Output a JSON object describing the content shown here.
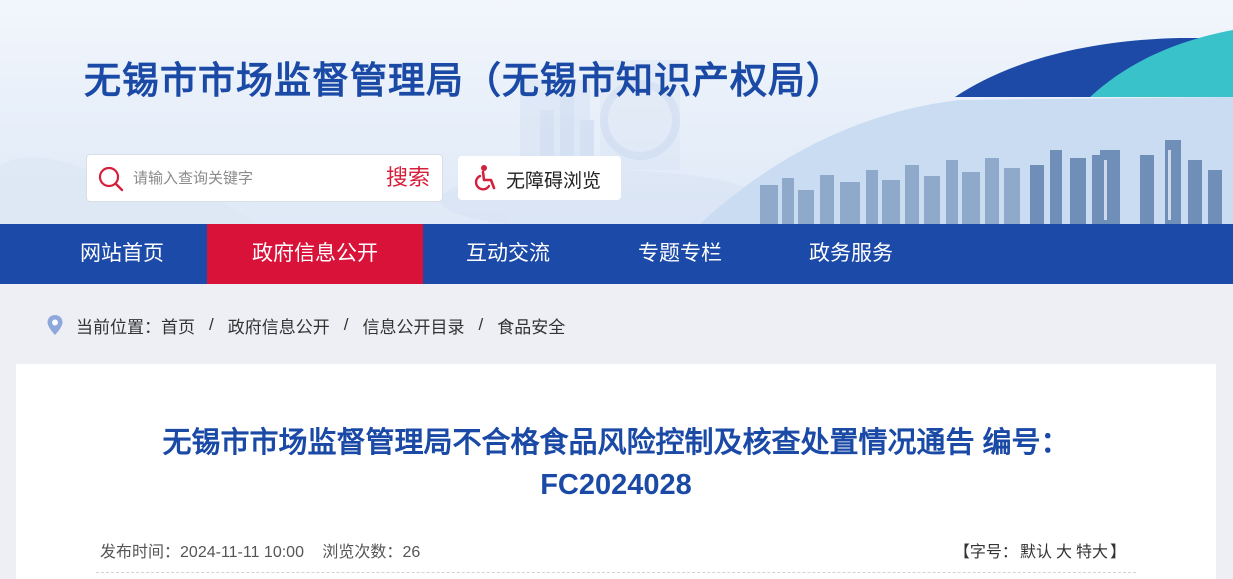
{
  "header": {
    "site_title": "无锡市市场监督管理局（无锡市知识产权局）"
  },
  "search": {
    "placeholder": "请输入查询关键字",
    "button_label": "搜索"
  },
  "accessibility": {
    "label": "无障碍浏览"
  },
  "nav": {
    "items": [
      {
        "label": "网站首页"
      },
      {
        "label": "政府信息公开"
      },
      {
        "label": "互动交流"
      },
      {
        "label": "专题专栏"
      },
      {
        "label": "政务服务"
      }
    ],
    "active_index": 1
  },
  "breadcrumb": {
    "prefix": "当前位置：",
    "items": [
      "首页",
      "政府信息公开",
      "信息公开目录",
      "食品安全"
    ],
    "separator": "/"
  },
  "article": {
    "title_line1": "无锡市市场监督管理局不合格食品风险控制及核查处置情况通告 编号：",
    "title_line2": "FC2024028",
    "publish_label": "发布时间：",
    "publish_time": "2024-11-11 10:00",
    "views_label": "浏览次数：",
    "views": "26"
  },
  "font_size": {
    "open": "【",
    "label": "字号：",
    "options": [
      "默认",
      "大",
      "特大"
    ],
    "close": "】"
  },
  "colors": {
    "brand_blue": "#1c4aa8",
    "active_red": "#d9123a",
    "title_blue": "#1a4aa6",
    "page_bg": "#eeeff4"
  },
  "icons": {
    "search": "search-icon",
    "accessibility": "wheelchair-icon",
    "location": "location-pin-icon"
  }
}
